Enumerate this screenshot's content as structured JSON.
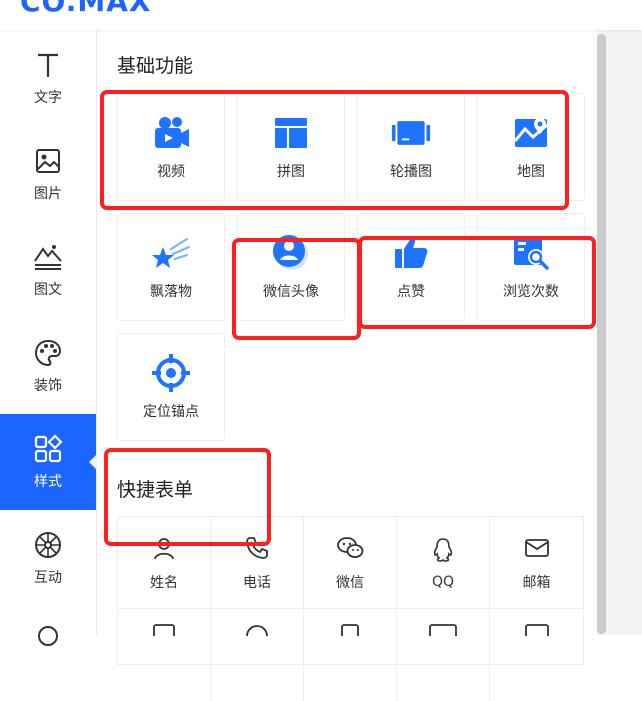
{
  "app": {
    "logo_text": "CO.MAX"
  },
  "sidebar": {
    "items": [
      {
        "label": "文字",
        "icon": "text-icon"
      },
      {
        "label": "图片",
        "icon": "image-icon"
      },
      {
        "label": "图文",
        "icon": "image-text-icon"
      },
      {
        "label": "装饰",
        "icon": "palette-icon"
      },
      {
        "label": "样式",
        "icon": "style-icon",
        "active": true
      },
      {
        "label": "互动",
        "icon": "interact-icon"
      }
    ]
  },
  "basic": {
    "title": "基础功能",
    "tiles": [
      {
        "label": "视频",
        "icon": "video-icon"
      },
      {
        "label": "拼图",
        "icon": "puzzle-icon"
      },
      {
        "label": "轮播图",
        "icon": "carousel-icon"
      },
      {
        "label": "地图",
        "icon": "map-icon"
      },
      {
        "label": "飘落物",
        "icon": "falling-icon"
      },
      {
        "label": "微信头像",
        "icon": "wechat-avatar-icon"
      },
      {
        "label": "点赞",
        "icon": "like-icon"
      },
      {
        "label": "浏览次数",
        "icon": "views-icon"
      },
      {
        "label": "定位锚点",
        "icon": "anchor-icon"
      }
    ]
  },
  "form": {
    "title": "快捷表单",
    "fields": [
      {
        "label": "姓名",
        "icon": "person-icon"
      },
      {
        "label": "电话",
        "icon": "phone-icon"
      },
      {
        "label": "微信",
        "icon": "wechat-icon"
      },
      {
        "label": "QQ",
        "icon": "qq-icon"
      },
      {
        "label": "邮箱",
        "icon": "mail-icon"
      }
    ]
  },
  "colors": {
    "accent": "#1a66ff",
    "highlight": "#ff1f1f",
    "icon_blue": "#1e73ff"
  }
}
